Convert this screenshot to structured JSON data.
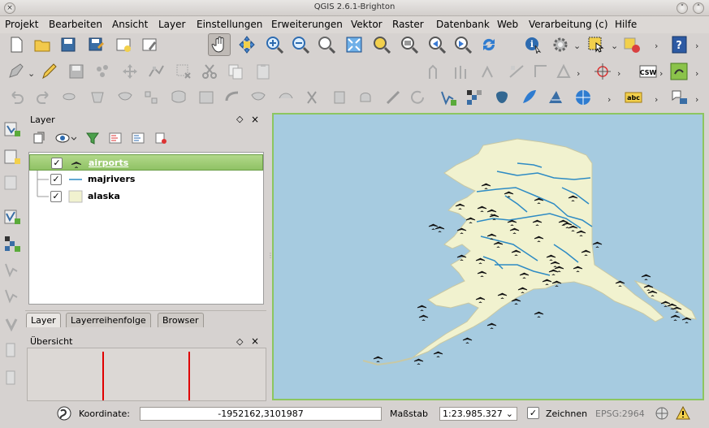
{
  "window": {
    "title": "QGIS 2.6.1-Brighton",
    "close_glyph": "×",
    "min_glyph": "˅",
    "max_glyph": "˄"
  },
  "menu": [
    "Projekt",
    "Bearbeiten",
    "Ansicht",
    "Layer",
    "Einstellungen",
    "Erweiterungen",
    "Vektor",
    "Raster",
    "Datenbank",
    "Web",
    "Verarbeitung (c)",
    "Hilfe"
  ],
  "toolbar": {
    "csw_label": "CSW",
    "abc_label": "abc"
  },
  "layers_panel": {
    "title": "Layer",
    "layers": [
      {
        "name": "airports",
        "checked": true,
        "selected": true,
        "symbol": "airplane-icon"
      },
      {
        "name": "majrivers",
        "checked": true,
        "selected": false,
        "symbol": "line-icon"
      },
      {
        "name": "alaska",
        "checked": true,
        "selected": false,
        "symbol": "polygon-icon"
      }
    ],
    "check_glyph": "✓"
  },
  "tabs": [
    "Layer",
    "Layerreihenfolge",
    "Browser"
  ],
  "overview": {
    "title": "Übersicht"
  },
  "statusbar": {
    "coord_label": "Koordinate:",
    "coord_value": "-1952162,3101987",
    "scale_label": "Maßstab",
    "scale_value": "1:23.985.327",
    "render_label": "Zeichnen",
    "crs": "EPSG:2964"
  },
  "colors": {
    "land": "#f1f2cf",
    "water": "#a6cbe0",
    "river": "#2e8bc4",
    "selection": "#9cc96f"
  }
}
